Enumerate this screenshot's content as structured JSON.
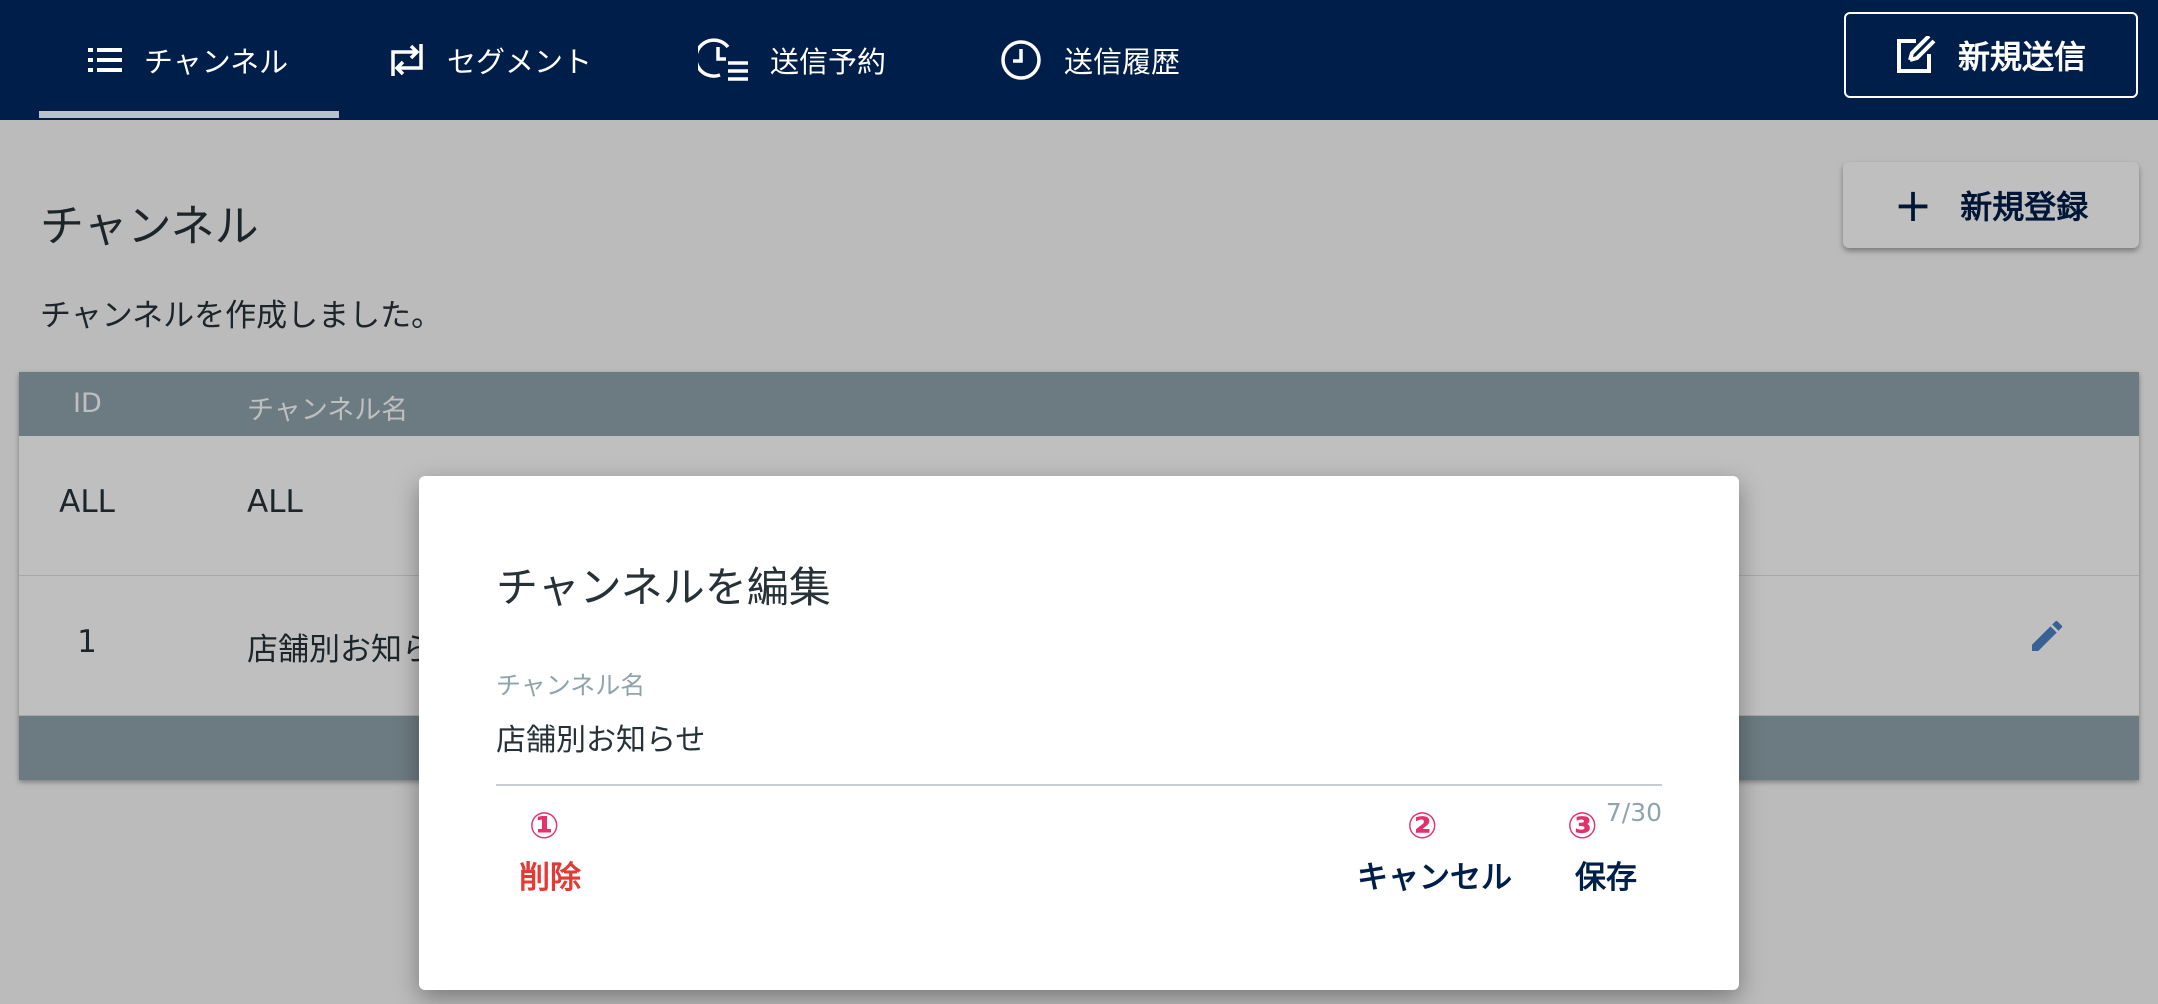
{
  "nav": {
    "tabs": [
      {
        "label": "チャンネル",
        "icon": "list-icon",
        "active": true
      },
      {
        "label": "セグメント",
        "icon": "swap-arrows-icon",
        "active": false
      },
      {
        "label": "送信予約",
        "icon": "clock-list-icon",
        "active": false
      },
      {
        "label": "送信履歴",
        "icon": "clock-icon",
        "active": false
      }
    ],
    "new_send_label": "新規送信"
  },
  "page": {
    "title": "チャンネル",
    "register_label": "新規登録",
    "message": "チャンネルを作成しました。"
  },
  "table": {
    "headers": [
      "ID",
      "チャンネル名"
    ],
    "rows": [
      {
        "id": "ALL",
        "name": "ALL"
      },
      {
        "id": "1",
        "name": "店舗別お知ら"
      }
    ]
  },
  "dialog": {
    "title": "チャンネルを編集",
    "field_label": "チャンネル名",
    "field_value": "店舗別お知らせ",
    "counter": "7/30",
    "delete_label": "削除",
    "cancel_label": "キャンセル",
    "save_label": "保存",
    "markers": [
      "①",
      "②",
      "③"
    ]
  },
  "colors": {
    "nav_bg": "#001e4a",
    "table_header": "#90a4ae",
    "delete": "#e53935",
    "marker": "#e3306e",
    "primary_text": "#001e4a"
  }
}
